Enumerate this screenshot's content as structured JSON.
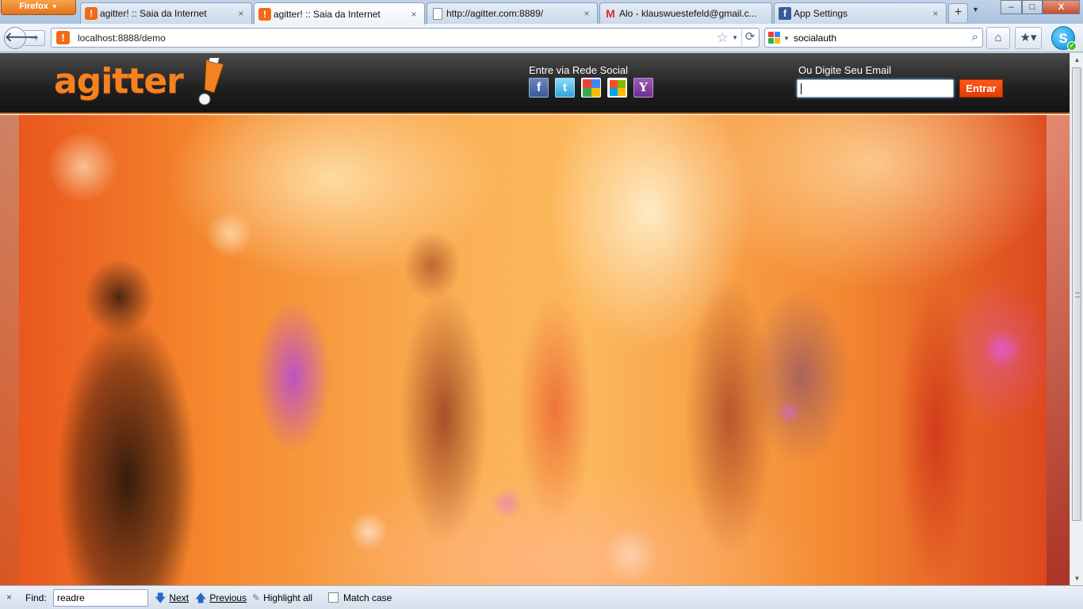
{
  "browser": {
    "app_menu_label": "Firefox",
    "tabs": [
      {
        "label": "agitter! :: Saia da Internet",
        "icon": "agitter-favicon-icon",
        "active": false
      },
      {
        "label": "agitter! :: Saia da Internet",
        "icon": "agitter-favicon-icon",
        "active": true
      },
      {
        "label": "http://agitter.com:8889/",
        "icon": "blank-page-icon",
        "active": false
      },
      {
        "label": "Alo - klauswuestefeld@gmail.c...",
        "icon": "gmail-icon",
        "active": false
      },
      {
        "label": "App Settings",
        "icon": "facebook-icon",
        "active": false
      }
    ],
    "tab_close_glyph": "×",
    "new_tab_glyph": "+",
    "url": "localhost:8888/demo",
    "search_text": "socialauth",
    "window_controls": {
      "minimize": "–",
      "maximize": "□",
      "close": "X"
    }
  },
  "page": {
    "logo_text": "agitter",
    "social_label": "Entre via Rede Social",
    "social_buttons": [
      {
        "name": "facebook",
        "glyph": "f",
        "color": "#3b5998"
      },
      {
        "name": "twitter",
        "glyph": "t",
        "color": "#2fa3d9"
      },
      {
        "name": "google",
        "glyph": "",
        "color": "#ffffff"
      },
      {
        "name": "windows-live",
        "glyph": "",
        "color": "#ffffff"
      },
      {
        "name": "yahoo",
        "glyph": "Y",
        "color": "#6e2d91"
      }
    ],
    "email_label": "Ou Digite Seu Email",
    "email_value": "",
    "submit_label": "Entrar",
    "accent_color": "#f58220",
    "button_color": "#e23b05"
  },
  "findbar": {
    "close_glyph": "×",
    "label": "Find:",
    "query": "readre",
    "next_label": "Next",
    "previous_label": "Previous",
    "highlight_label": "Highlight all",
    "match_case_label": "Match case",
    "match_case_checked": false
  }
}
